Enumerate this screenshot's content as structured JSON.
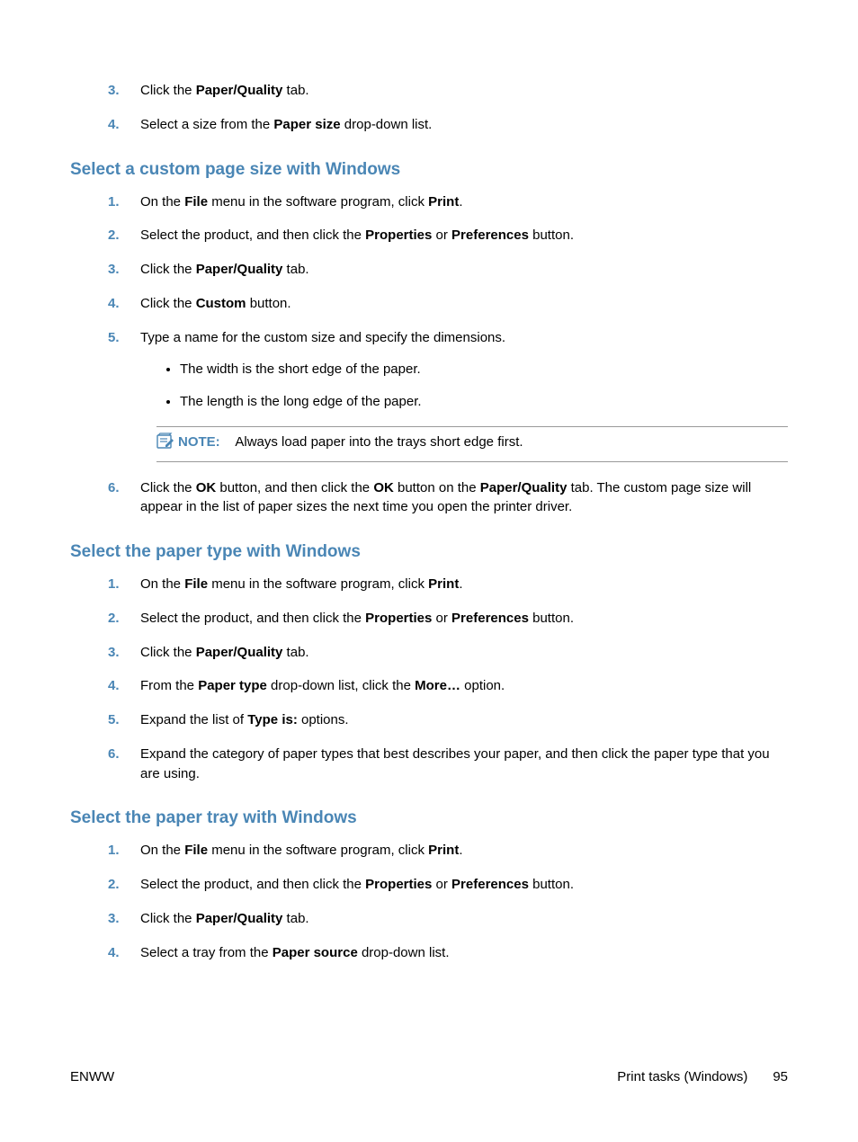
{
  "section0": {
    "items": [
      {
        "num": "3.",
        "parts": [
          "Click the ",
          [
            "b",
            "Paper/Quality"
          ],
          " tab."
        ]
      },
      {
        "num": "4.",
        "parts": [
          "Select a size from the ",
          [
            "b",
            "Paper size"
          ],
          " drop-down list."
        ]
      }
    ]
  },
  "section1": {
    "heading": "Select a custom page size with Windows",
    "items": [
      {
        "num": "1.",
        "parts": [
          "On the ",
          [
            "b",
            "File"
          ],
          " menu in the software program, click ",
          [
            "b",
            "Print"
          ],
          "."
        ]
      },
      {
        "num": "2.",
        "parts": [
          "Select the product, and then click the ",
          [
            "b",
            "Properties"
          ],
          " or ",
          [
            "b",
            "Preferences"
          ],
          " button."
        ]
      },
      {
        "num": "3.",
        "parts": [
          "Click the ",
          [
            "b",
            "Paper/Quality"
          ],
          " tab."
        ]
      },
      {
        "num": "4.",
        "parts": [
          "Click the ",
          [
            "b",
            "Custom"
          ],
          " button."
        ]
      },
      {
        "num": "5.",
        "parts": [
          "Type a name for the custom size and specify the dimensions."
        ],
        "sub": [
          "The width is the short edge of the paper.",
          "The length is the long edge of the paper."
        ]
      },
      {
        "num": "6.",
        "parts": [
          "Click the ",
          [
            "b",
            "OK"
          ],
          " button, and then click the ",
          [
            "b",
            "OK"
          ],
          " button on the ",
          [
            "b",
            "Paper/Quality"
          ],
          " tab. The custom page size will appear in the list of paper sizes the next time you open the printer driver."
        ]
      }
    ],
    "note": {
      "label": "NOTE:",
      "text": "Always load paper into the trays short edge first."
    }
  },
  "section2": {
    "heading": "Select the paper type with Windows",
    "items": [
      {
        "num": "1.",
        "parts": [
          "On the ",
          [
            "b",
            "File"
          ],
          " menu in the software program, click ",
          [
            "b",
            "Print"
          ],
          "."
        ]
      },
      {
        "num": "2.",
        "parts": [
          "Select the product, and then click the ",
          [
            "b",
            "Properties"
          ],
          " or ",
          [
            "b",
            "Preferences"
          ],
          " button."
        ]
      },
      {
        "num": "3.",
        "parts": [
          "Click the ",
          [
            "b",
            "Paper/Quality"
          ],
          " tab."
        ]
      },
      {
        "num": "4.",
        "parts": [
          "From the ",
          [
            "b",
            "Paper type"
          ],
          " drop-down list, click the ",
          [
            "b",
            "More…"
          ],
          " option."
        ]
      },
      {
        "num": "5.",
        "parts": [
          "Expand the list of ",
          [
            "b",
            "Type is:"
          ],
          " options."
        ]
      },
      {
        "num": "6.",
        "parts": [
          "Expand the category of paper types that best describes your paper, and then click the paper type that you are using."
        ]
      }
    ]
  },
  "section3": {
    "heading": "Select the paper tray with Windows",
    "items": [
      {
        "num": "1.",
        "parts": [
          "On the ",
          [
            "b",
            "File"
          ],
          " menu in the software program, click ",
          [
            "b",
            "Print"
          ],
          "."
        ]
      },
      {
        "num": "2.",
        "parts": [
          "Select the product, and then click the ",
          [
            "b",
            "Properties"
          ],
          " or ",
          [
            "b",
            "Preferences"
          ],
          " button."
        ]
      },
      {
        "num": "3.",
        "parts": [
          "Click the ",
          [
            "b",
            "Paper/Quality"
          ],
          " tab."
        ]
      },
      {
        "num": "4.",
        "parts": [
          "Select a tray from the ",
          [
            "b",
            "Paper source"
          ],
          " drop-down list."
        ]
      }
    ]
  },
  "footer": {
    "left": "ENWW",
    "rightLabel": "Print tasks (Windows)",
    "page": "95"
  }
}
